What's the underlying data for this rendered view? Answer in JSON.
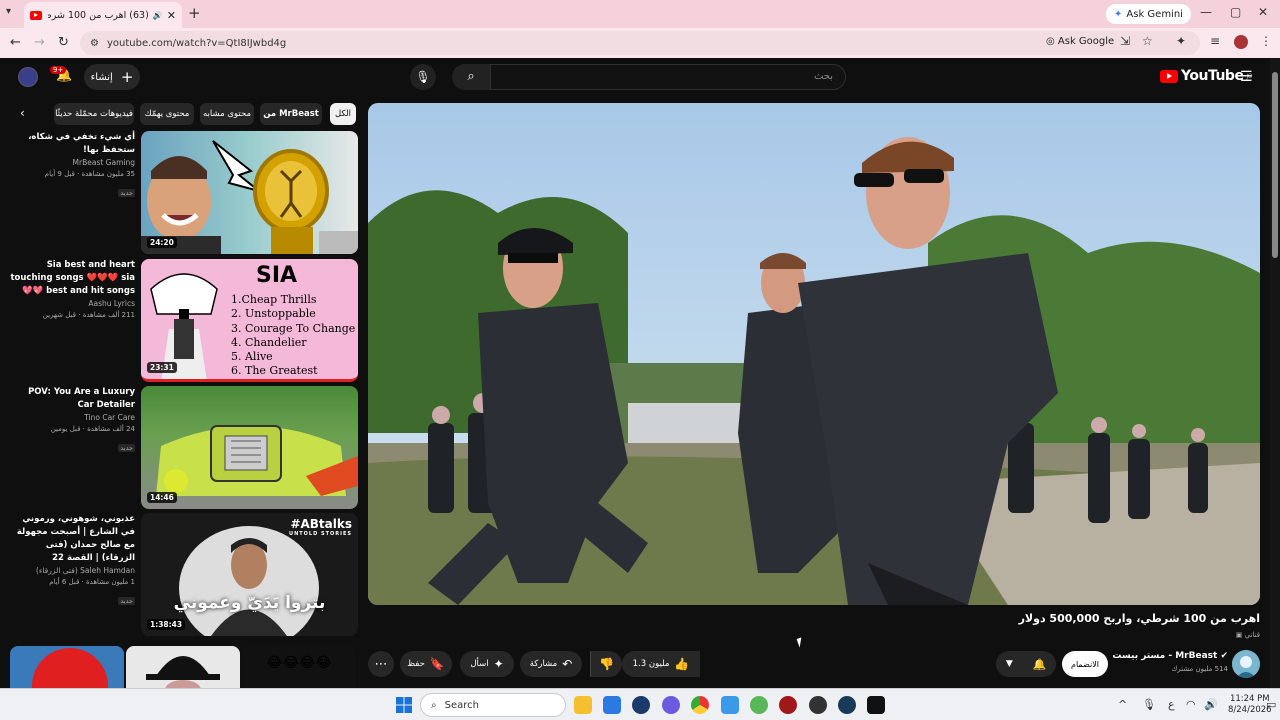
{
  "browser": {
    "tab_title": "(63) اهرب من 100 شرطي، وا",
    "url": "youtube.com/watch?v=QtI8IJwbd4g",
    "ask_gemini": "Ask Gemini",
    "ask_google": "Ask Google"
  },
  "yt": {
    "logo": "YouTube",
    "logo_country": "JO",
    "search_placeholder": "بحث",
    "create_label": "إنشاء",
    "notif_count": "9+"
  },
  "chips": [
    "الكل",
    "من MrBeast",
    "محتوى مشابه",
    "محتوى يهمّك",
    "فيديوهات محمّلة حديثًا"
  ],
  "recommendations": [
    {
      "title": "أي شيء تخفي في شكاه، ستحفظ بها!",
      "channel": "MrBeast Gaming",
      "views": "35 مليون مشاهدة · قبل 9 أيام",
      "badge": "جديد",
      "duration": "24:20"
    },
    {
      "title": "Sia best and heart touching songs ❤️❤️❤️ sia best and hit songs 💖💖",
      "channel": "Aashu Lyrics",
      "views": "211 ألف مشاهدة · قبل شهرين",
      "badge": "",
      "duration": "23:31"
    },
    {
      "title": "POV: You Are a Luxury Car Detailer",
      "channel": "Tino Car Care",
      "views": "24 ألف مشاهدة · قبل يومين",
      "badge": "جديد",
      "duration": "14:46"
    },
    {
      "title": "عذبوني، شوهوني، ورموني في الشارع | أصبحت مجهولة مع صالح حمدان (فتى الزرقاء) | القصة 22",
      "channel": "Saleh Hamdan (فتى الزرقاء)",
      "views": "1 مليون مشاهدة · قبل 6 أيام",
      "badge": "جديد",
      "duration": "1:38:43"
    }
  ],
  "sia_list": [
    "1.Cheap Thrills",
    "2. Unstoppable",
    "3. Courage To Change",
    "4. Chandelier",
    "5. Alive",
    "6. The Greatest"
  ],
  "sia_title": "SIA",
  "abtalks": "#ABtalks",
  "abtalks_sub": "UNTOLD STORIES",
  "abtalks_caption": "بتروا يَدَيّ وعموني",
  "video": {
    "title": "اهرب من 100 شرطي، واربح 500,000 دولار",
    "sub_badge": "قناتي",
    "channel": "MrBeast - مستر بيست",
    "subscribers": "514 مليون مشترك",
    "join": "الانضمام",
    "likes": "1.3 مليون",
    "share": "مشاركة",
    "ask": "اسأل",
    "save": "حفظ"
  },
  "shorts_emoji": "😂😂😂😂",
  "taskbar": {
    "search": "Search",
    "time": "11:24 PM",
    "date": "8/24/2026",
    "lang": "ع"
  }
}
